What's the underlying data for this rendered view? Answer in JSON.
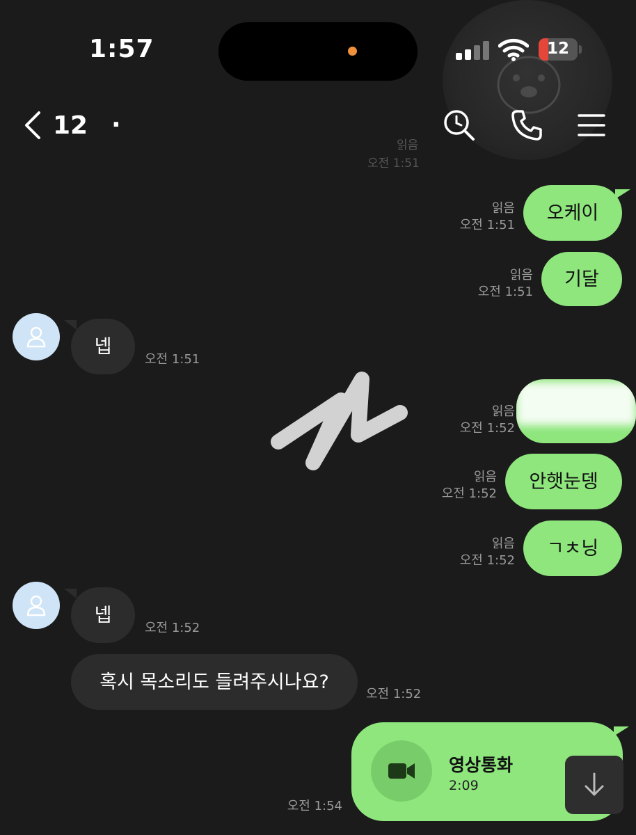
{
  "status_bar": {
    "time": "1:57",
    "battery_level": "12",
    "battery_color": "#e5463a"
  },
  "header": {
    "title": "12",
    "title_suffix": "."
  },
  "faded_meta": {
    "read": "읽음",
    "time": "오전 1:51"
  },
  "messages": [
    {
      "sender": "me",
      "text": "오케이",
      "read": "읽음",
      "time": "오전 1:51"
    },
    {
      "sender": "me",
      "text": "기달",
      "read": "읽음",
      "time": "오전 1:51"
    },
    {
      "sender": "them",
      "text": "넵",
      "time": "오전 1:51"
    },
    {
      "sender": "me",
      "text": "",
      "redacted": true,
      "read": "읽음",
      "time": "오전 1:52"
    },
    {
      "sender": "me",
      "text": "안햇눈뎅",
      "read": "읽음",
      "time": "오전 1:52"
    },
    {
      "sender": "me",
      "text": "ㄱㅊ닝",
      "read": "읽음",
      "time": "오전 1:52"
    },
    {
      "sender": "them",
      "text": "넵",
      "time": "오전 1:52"
    },
    {
      "sender": "them",
      "text": "혹시 목소리도 들려주시나요?",
      "time": "오전 1:52"
    }
  ],
  "video_call": {
    "title": "영상통화",
    "duration": "2:09",
    "time": "오전 1:54"
  },
  "colors": {
    "my_bubble": "#8ee67d",
    "their_bubble": "#2c2c2c",
    "background": "#1b1b1b",
    "avatar": "#cfe4f6"
  },
  "icons": [
    "back-chevron-icon",
    "search-icon",
    "phone-icon",
    "menu-icon",
    "avatar-person-icon",
    "video-camera-icon",
    "arrow-down-icon"
  ]
}
